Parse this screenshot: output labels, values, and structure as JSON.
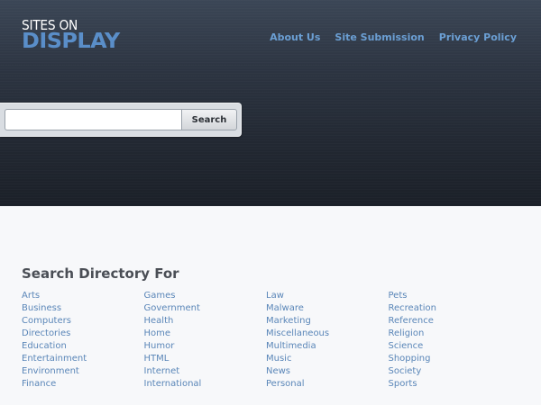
{
  "header": {
    "logo_top": "SITES ON",
    "logo_bottom": "DISPLAY",
    "nav": [
      {
        "label": "About Us"
      },
      {
        "label": "Site Submission"
      },
      {
        "label": "Privacy Policy"
      }
    ]
  },
  "search": {
    "placeholder": "",
    "value": "",
    "button_label": "Search"
  },
  "directory": {
    "title": "Search Directory For",
    "columns": [
      [
        "Arts",
        "Business",
        "Computers",
        "Directories",
        "Education",
        "Entertainment",
        "Environment",
        "Finance"
      ],
      [
        "Games",
        "Government",
        "Health",
        "Home",
        "Humor",
        "HTML",
        "Internet",
        "International"
      ],
      [
        "Law",
        "Malware",
        "Marketing",
        "Miscellaneous",
        "Multimedia",
        "Music",
        "News",
        "Personal"
      ],
      [
        "Pets",
        "Recreation",
        "Reference",
        "Religion",
        "Science",
        "Shopping",
        "Society",
        "Sports"
      ]
    ]
  },
  "colors": {
    "link": "#5a86b8",
    "nav": "#6b9fd4",
    "logo_accent": "#5a8ec9",
    "header_bg": "#2c3441",
    "page_bg": "#f7f8fa"
  }
}
